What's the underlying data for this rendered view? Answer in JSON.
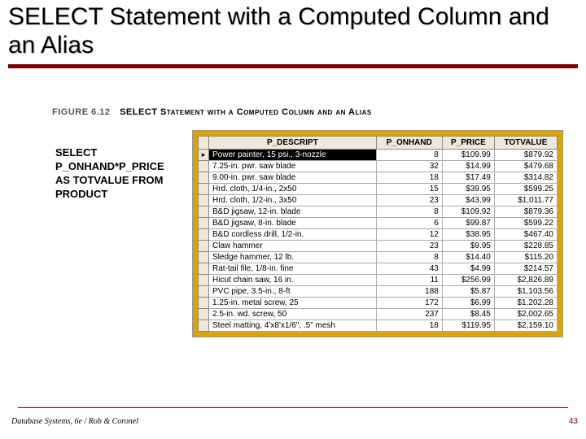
{
  "title": "SELECT Statement with a Computed Column and an Alias",
  "figure": {
    "num": "FIGURE 6.12",
    "caption": "SELECT Statement with a Computed Column and an Alias"
  },
  "sql": {
    "l1": "SELECT",
    "l2": "P_ONHAND*P_PRICE",
    "l3": "AS TOTVALUE FROM",
    "l4": "PRODUCT"
  },
  "grid": {
    "headers": [
      "P_DESCRIPT",
      "P_ONHAND",
      "P_PRICE",
      "TOTVALUE"
    ],
    "rows": [
      {
        "desc": "Power painter, 15 psi., 3-nozzle",
        "onhand": "8",
        "price": "$109.99",
        "tot": "$879.92"
      },
      {
        "desc": "7.25-in. pwr. saw blade",
        "onhand": "32",
        "price": "$14.99",
        "tot": "$479.68"
      },
      {
        "desc": "9.00-in. pwr. saw blade",
        "onhand": "18",
        "price": "$17.49",
        "tot": "$314.82"
      },
      {
        "desc": "Hrd. cloth, 1/4-in., 2x50",
        "onhand": "15",
        "price": "$39.95",
        "tot": "$599.25"
      },
      {
        "desc": "Hrd. cloth, 1/2-in., 3x50",
        "onhand": "23",
        "price": "$43.99",
        "tot": "$1,011.77"
      },
      {
        "desc": "B&D jigsaw, 12-in. blade",
        "onhand": "8",
        "price": "$109.92",
        "tot": "$879.36"
      },
      {
        "desc": "B&D jigsaw, 8-in. blade",
        "onhand": "6",
        "price": "$99.87",
        "tot": "$599.22"
      },
      {
        "desc": "B&D cordless drill, 1/2-in.",
        "onhand": "12",
        "price": "$38.95",
        "tot": "$467.40"
      },
      {
        "desc": "Claw hammer",
        "onhand": "23",
        "price": "$9.95",
        "tot": "$228.85"
      },
      {
        "desc": "Sledge hammer, 12 lb.",
        "onhand": "8",
        "price": "$14.40",
        "tot": "$115.20"
      },
      {
        "desc": "Rat-tail file, 1/8-in. fine",
        "onhand": "43",
        "price": "$4.99",
        "tot": "$214.57"
      },
      {
        "desc": "Hicut chain saw, 16 in.",
        "onhand": "11",
        "price": "$256.99",
        "tot": "$2,826.89"
      },
      {
        "desc": "PVC pipe, 3.5-in., 8-ft",
        "onhand": "188",
        "price": "$5.87",
        "tot": "$1,103.56"
      },
      {
        "desc": "1.25-in. metal screw, 25",
        "onhand": "172",
        "price": "$6.99",
        "tot": "$1,202.28"
      },
      {
        "desc": "2.5-in. wd. screw, 50",
        "onhand": "237",
        "price": "$8.45",
        "tot": "$2,002.65"
      },
      {
        "desc": "Steel matting, 4'x8'x1/6\", .5\" mesh",
        "onhand": "18",
        "price": "$119.95",
        "tot": "$2,159.10"
      }
    ]
  },
  "footer": "Database Systems, 6e / Rob & Coronel",
  "page": "43"
}
